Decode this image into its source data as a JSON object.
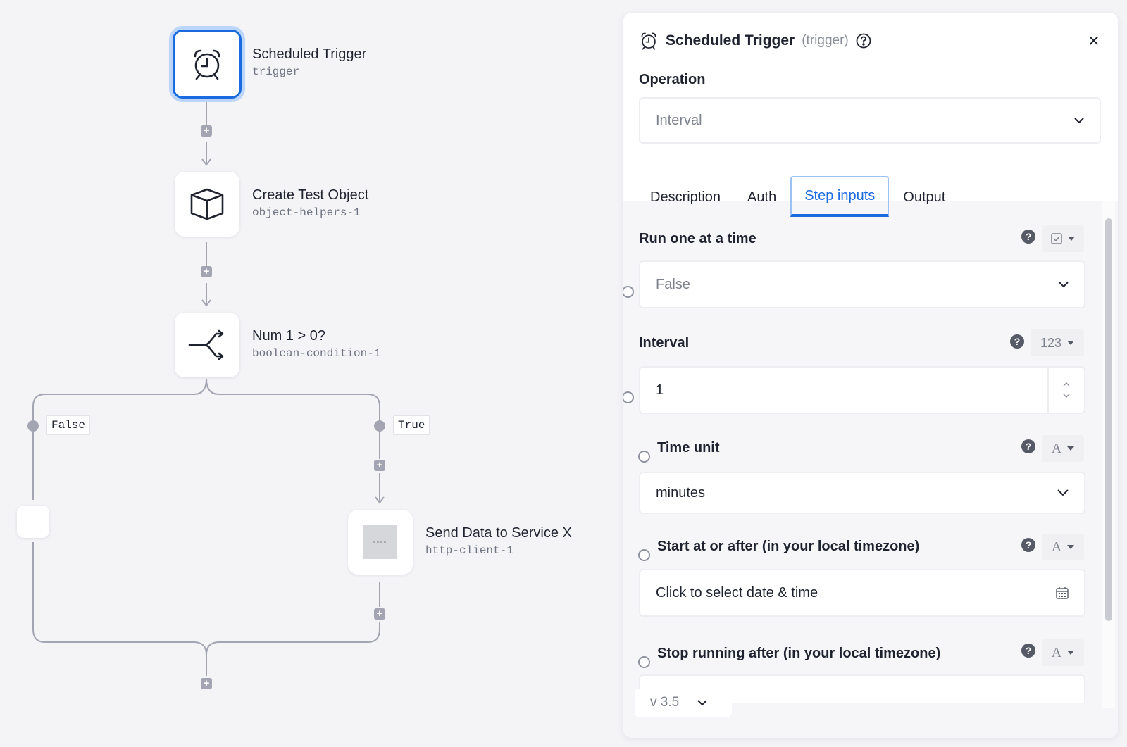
{
  "canvas": {
    "nodes": {
      "trigger": {
        "title": "Scheduled Trigger",
        "sub": "trigger"
      },
      "create": {
        "title": "Create Test Object",
        "sub": "object-helpers-1"
      },
      "condition": {
        "title": "Num 1 > 0?",
        "sub": "boolean-condition-1"
      },
      "send": {
        "title": "Send Data to Service X",
        "sub": "http-client-1"
      }
    },
    "branches": {
      "false_label": "False",
      "true_label": "True"
    },
    "plus_glyph": "+"
  },
  "panel": {
    "header": {
      "title": "Scheduled Trigger",
      "sub": "(trigger)"
    },
    "operation": {
      "label": "Operation",
      "value": "Interval"
    },
    "tabs": [
      "Description",
      "Auth",
      "Step inputs",
      "Output"
    ],
    "active_tab": "Step inputs",
    "fields": {
      "run_one": {
        "label": "Run one at a time",
        "value": "False"
      },
      "interval": {
        "label": "Interval",
        "type": "123",
        "value": "1"
      },
      "time_unit": {
        "label": "Time unit",
        "type": "A",
        "value": "minutes"
      },
      "start": {
        "label": "Start at or after (in your local timezone)",
        "type": "A",
        "placeholder": "Click to select date & time"
      },
      "stop": {
        "label": "Stop running after (in your local timezone)",
        "type": "A"
      }
    },
    "version": "v 3.5",
    "help_glyph": "?",
    "close_glyph": "×"
  },
  "colors": {
    "accent": "#1a6ae0",
    "wire": "#a3a6b2"
  }
}
